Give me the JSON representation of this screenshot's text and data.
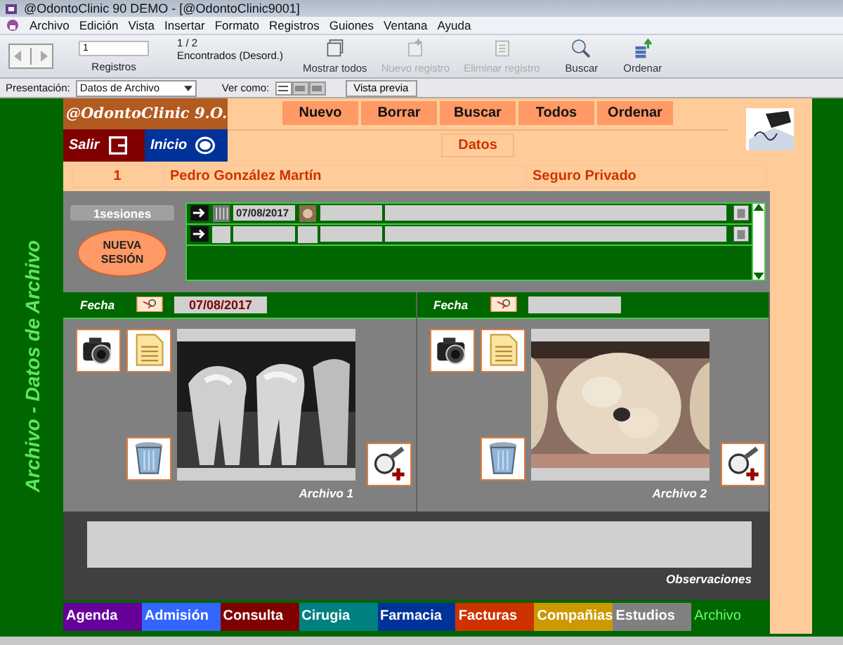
{
  "window": {
    "title": "@OdontoClinic 90 DEMO - [@OdontoClinic9001]"
  },
  "menu": [
    "Archivo",
    "Edición",
    "Vista",
    "Insertar",
    "Formato",
    "Registros",
    "Guiones",
    "Ventana",
    "Ayuda"
  ],
  "toolbar": {
    "record": "1",
    "record_label": "Registros",
    "count": "1 / 2",
    "found": "Encontrados (Desord.)",
    "buttons": [
      {
        "label": "Mostrar todos",
        "kind": "showall",
        "disabled": false
      },
      {
        "label": "Nuevo registro",
        "kind": "new",
        "disabled": true
      },
      {
        "label": "Eliminar registro",
        "kind": "delete",
        "disabled": true
      },
      {
        "label": "Buscar",
        "kind": "find",
        "disabled": false
      },
      {
        "label": "Ordenar",
        "kind": "sort",
        "disabled": false
      }
    ]
  },
  "layout_bar": {
    "label": "Presentación:",
    "layout": "Datos de Archivo",
    "view_label": "Ver como:",
    "views": [
      {
        "selected": true
      },
      {
        "selected": false
      },
      {
        "selected": false
      }
    ],
    "preview": "Vista previa"
  },
  "side_title": "Archivo - Datos de Archivo",
  "logo": "@OdontoClinic 9.O.",
  "exit": "Salir",
  "home": "Inicio",
  "actions": [
    "Nuevo",
    "Borrar",
    "Buscar",
    "Todos",
    "Ordenar"
  ],
  "section": "Datos",
  "patient": {
    "number": "1",
    "name": "Pedro González Martín",
    "insurance": "Seguro Privado"
  },
  "sessions_count": "1sesiones",
  "new_session": "NUEVA SESIÓN",
  "sessions": [
    {
      "date": "07/08/2017",
      "thumbnail": true
    },
    {
      "thumbnail": false
    }
  ],
  "files": [
    {
      "date_label": "Fecha",
      "date": "07/08/2017",
      "caption": "Archivo 1",
      "kind": "xray"
    },
    {
      "date_label": "Fecha",
      "caption": "Archivo 2"
    }
  ],
  "observations_label": "Observaciones",
  "tabs": [
    {
      "label": "Agenda",
      "color": "#660099",
      "selected": false
    },
    {
      "label": "Admisión",
      "color": "#3366ff",
      "selected": false
    },
    {
      "label": "Consulta",
      "color": "#800000",
      "selected": false
    },
    {
      "label": "Cirugia",
      "color": "#008080",
      "selected": false
    },
    {
      "label": "Farmacia",
      "color": "#003399",
      "selected": false
    },
    {
      "label": "Facturas",
      "color": "#cc3300",
      "selected": false
    },
    {
      "label": "Compañias",
      "color": "#cc9900",
      "selected": false
    },
    {
      "label": "Estudios",
      "color": "#808080",
      "selected": false
    },
    {
      "label": "Archivo",
      "color": "#006600",
      "selected": true
    }
  ]
}
